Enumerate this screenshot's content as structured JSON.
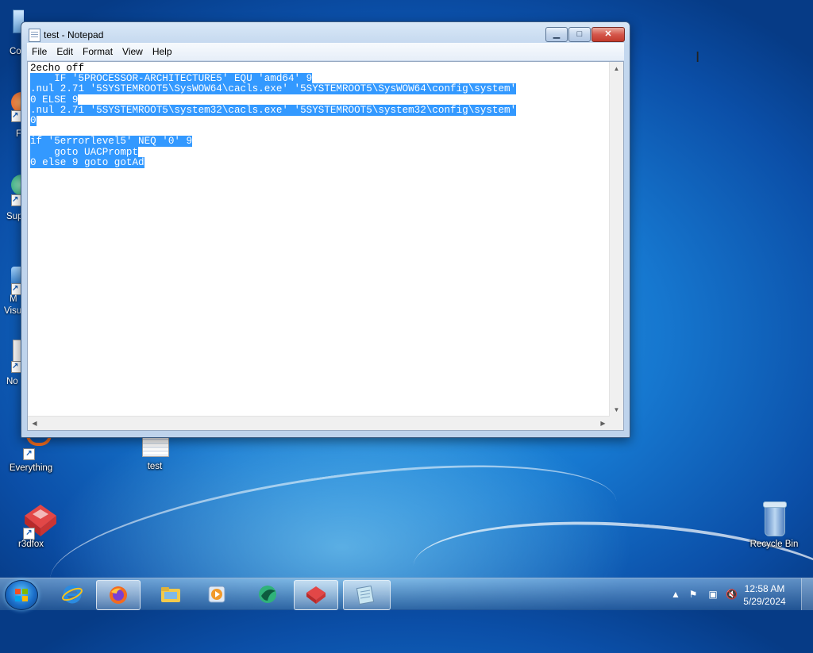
{
  "desktop": {
    "icons": [
      {
        "label": "Everything",
        "icon": "everything-icon"
      },
      {
        "label": "test",
        "icon": "text-file-icon"
      },
      {
        "label": "r3dfox",
        "icon": "r3dfox-icon"
      },
      {
        "label": "Recycle Bin",
        "icon": "recycle-bin-icon"
      }
    ],
    "edge_labels": [
      "Co",
      "F",
      "Sup",
      "M",
      "Visu",
      "No"
    ]
  },
  "window": {
    "title": "test - Notepad",
    "menu": [
      "File",
      "Edit",
      "Format",
      "View",
      "Help"
    ],
    "lines": [
      {
        "text": "2echo off",
        "selected": false
      },
      {
        "text": "    IF '5PROCESSOR-ARCHITECTURE5' EQU 'amd64' 9",
        "selected": true
      },
      {
        "text": ".nul 2.71 '5SYSTEMROOT5\\SysWOW64\\cacls.exe' '5SYSTEMROOT5\\SysWOW64\\config\\system'",
        "selected": true
      },
      {
        "text": "0 ELSE 9",
        "selected": true
      },
      {
        "text": ".nul 2.71 '5SYSTEMROOT5\\system32\\cacls.exe' '5SYSTEMROOT5\\system32\\config\\system'",
        "selected": true
      },
      {
        "text": "0",
        "selected": true
      },
      {
        "text": "",
        "selected": false
      },
      {
        "text": "if '5errorlevel5' NEQ '0' 9",
        "selected": true
      },
      {
        "text": "    goto UACPrompt",
        "selected": true
      },
      {
        "text": "0 else 9 goto gotAd",
        "selected": true
      }
    ],
    "buttons": {
      "minimize": "▁",
      "maximize": "□",
      "close": "✕"
    }
  },
  "taskbar": {
    "items": [
      "start-orb",
      "internet-explorer",
      "firefox",
      "file-explorer",
      "media-player",
      "browser-green",
      "r3dfox",
      "notepad"
    ],
    "active": "notepad",
    "clock": {
      "time": "12:58 AM",
      "date": "5/29/2024"
    }
  },
  "colors": {
    "selection": "#3399ff",
    "desktop": "#1677cf"
  }
}
